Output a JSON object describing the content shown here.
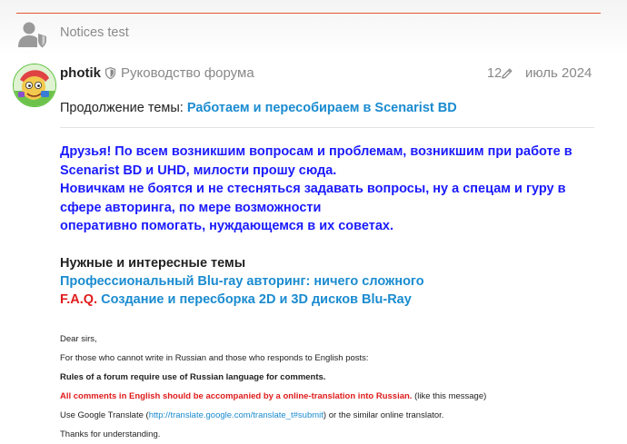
{
  "notice": {
    "title": "Notices test"
  },
  "post": {
    "username": "photik",
    "user_title": "Руководство форума",
    "edit_count": "12",
    "date": "июль 2024",
    "continuation_label": "Продолжение темы:",
    "continuation_link": "Работаем и пересобираем в Scenarist BD",
    "blue_lines": [
      "Друзья! По всем возникшим вопросам и проблемам, возникшим при работе в",
      "Scenarist BD и UHD, милости прошу сюда.",
      "Новичкам не боятся и не стесняться задавать вопросы, ну а спецам и гуру в",
      "сфере авторинга, по мере возможности",
      "оперативно помогать, нуждающемся в их советах."
    ],
    "topics_heading": "Нужные и интересные темы",
    "topic_link_1": "Профессиональный Blu-ray авторинг: ничего сложного",
    "faq_label": "F.A.Q.",
    "topic_link_2": "Создание и пересборка 2D и 3D дисков Blu-Ray",
    "small": {
      "line1": "Dear sirs,",
      "line2": "For those who cannot write in Russian and those who responds to English posts:",
      "line3": "Rules of a forum require use of Russian language for comments.",
      "line4_red": "All comments in English should be accompanied by a online-translation into Russian.",
      "line4_tail": "(like this message)",
      "line5_a": "Use Google Translate (",
      "line5_link": "http://translate.google.com/translate_t#submit",
      "line5_b": ") or the similar online translator.",
      "line6": "Thanks for understanding."
    }
  },
  "colors": {
    "accent_red": "#e45735",
    "link_blue": "#1a8bd0",
    "text_blue": "#1a1aff"
  },
  "icons": [
    "user-shield-icon",
    "moderator-shield-icon",
    "pencil-icon",
    "avatar-image"
  ]
}
